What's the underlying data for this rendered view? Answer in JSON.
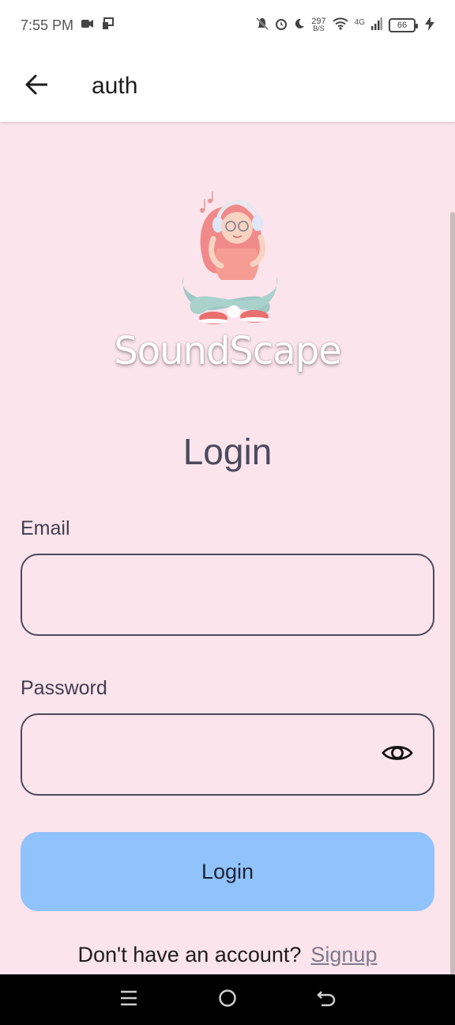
{
  "status_bar": {
    "time": "7:55 PM",
    "net_speed_value": "297",
    "net_speed_unit": "B/S",
    "network_type": "4G",
    "battery_level": "66"
  },
  "app_bar": {
    "title": "auth"
  },
  "logo": {
    "brand_name": "SoundScape"
  },
  "form": {
    "heading": "Login",
    "email_label": "Email",
    "email_value": "",
    "password_label": "Password",
    "password_value": "",
    "submit_label": "Login"
  },
  "footer": {
    "prompt": "Don't have an account?",
    "signup_label": "Signup"
  },
  "colors": {
    "background": "#fce4ec",
    "button": "#90c2fb",
    "field_border": "#4d4a58"
  }
}
